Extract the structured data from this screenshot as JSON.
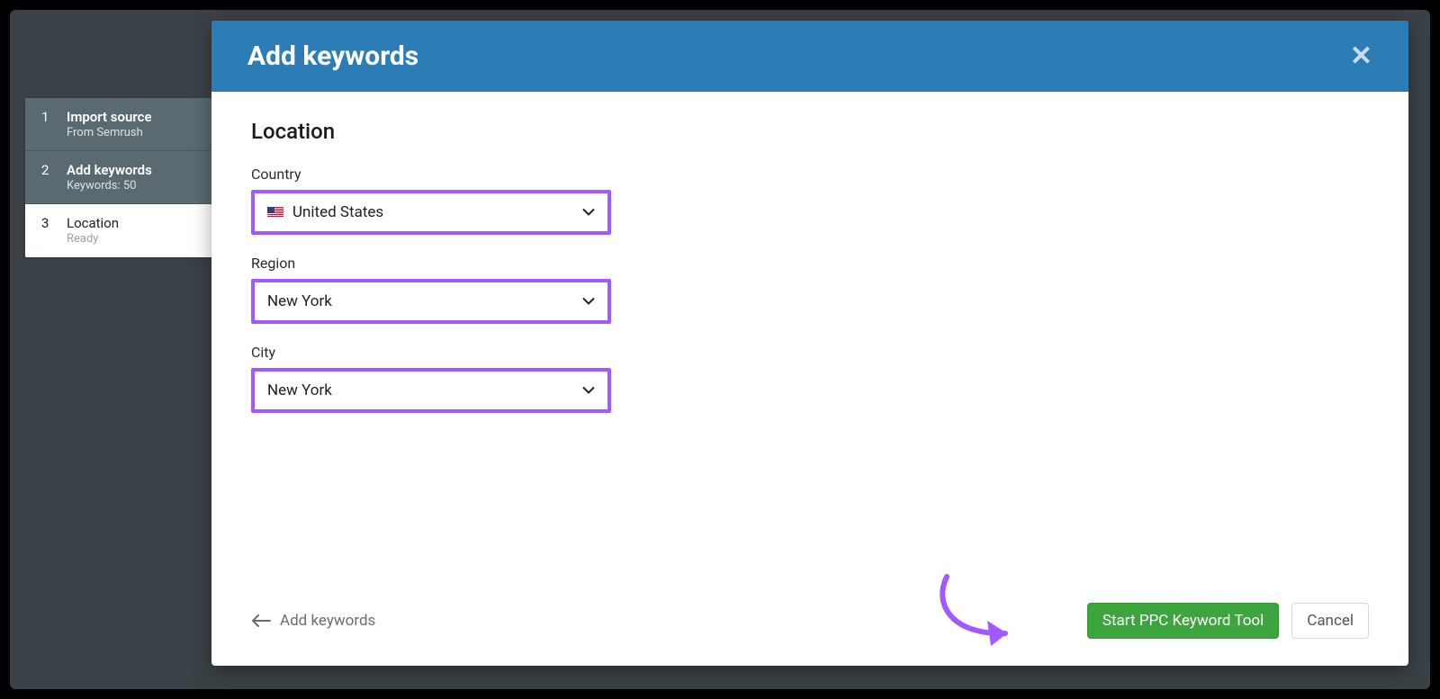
{
  "modal": {
    "title": "Add keywords",
    "section_title": "Location",
    "fields": {
      "country": {
        "label": "Country",
        "value": "United States"
      },
      "region": {
        "label": "Region",
        "value": "New York"
      },
      "city": {
        "label": "City",
        "value": "New York"
      }
    },
    "footer": {
      "back": "Add keywords",
      "primary": "Start PPC Keyword Tool",
      "cancel": "Cancel"
    }
  },
  "stepper": [
    {
      "num": "1",
      "label": "Import source",
      "sub": "From Semrush",
      "tone": "dark"
    },
    {
      "num": "2",
      "label": "Add keywords",
      "sub": "Keywords: 50",
      "tone": "dark"
    },
    {
      "num": "3",
      "label": "Location",
      "sub": "Ready",
      "tone": "light"
    }
  ]
}
